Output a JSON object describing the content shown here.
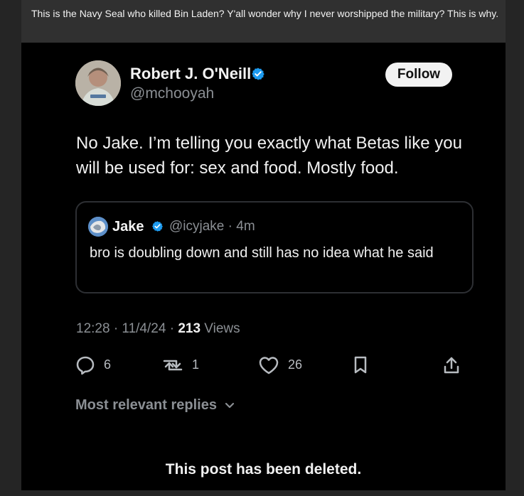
{
  "top_post": {
    "text": "This is the Navy Seal who killed Bin Laden? Y'all wonder why I never worshipped the military? This is why."
  },
  "tweet": {
    "author_name": "Robert J. O'Neill",
    "author_handle": "@mchooyah",
    "follow_label": "Follow",
    "text": "No Jake. I’m telling you exactly what Betas like you will be used for: sex and food. Mostly food.",
    "quote": {
      "author_name": "Jake",
      "meta": "@icyjake · 4m",
      "text": "bro is doubling down and still has no idea what he said"
    },
    "timestamp": "12:28 · 11/4/24 · ",
    "views": "213",
    "views_label": " Views",
    "actions": {
      "replies": "6",
      "reposts": "1",
      "likes": "26"
    },
    "replies_filter": "Most relevant replies",
    "deleted_notice": "This post has been deleted."
  },
  "colors": {
    "background": "#000000",
    "accent": "#1d9bf0",
    "text": "#f1f1f1",
    "muted": "#8b8f94"
  },
  "icons": {
    "verified": "verified-badge-icon",
    "reply": "reply-icon",
    "repost": "repost-icon",
    "like": "heart-icon",
    "bookmark": "bookmark-icon",
    "share": "share-icon",
    "chevron": "chevron-down-icon"
  }
}
